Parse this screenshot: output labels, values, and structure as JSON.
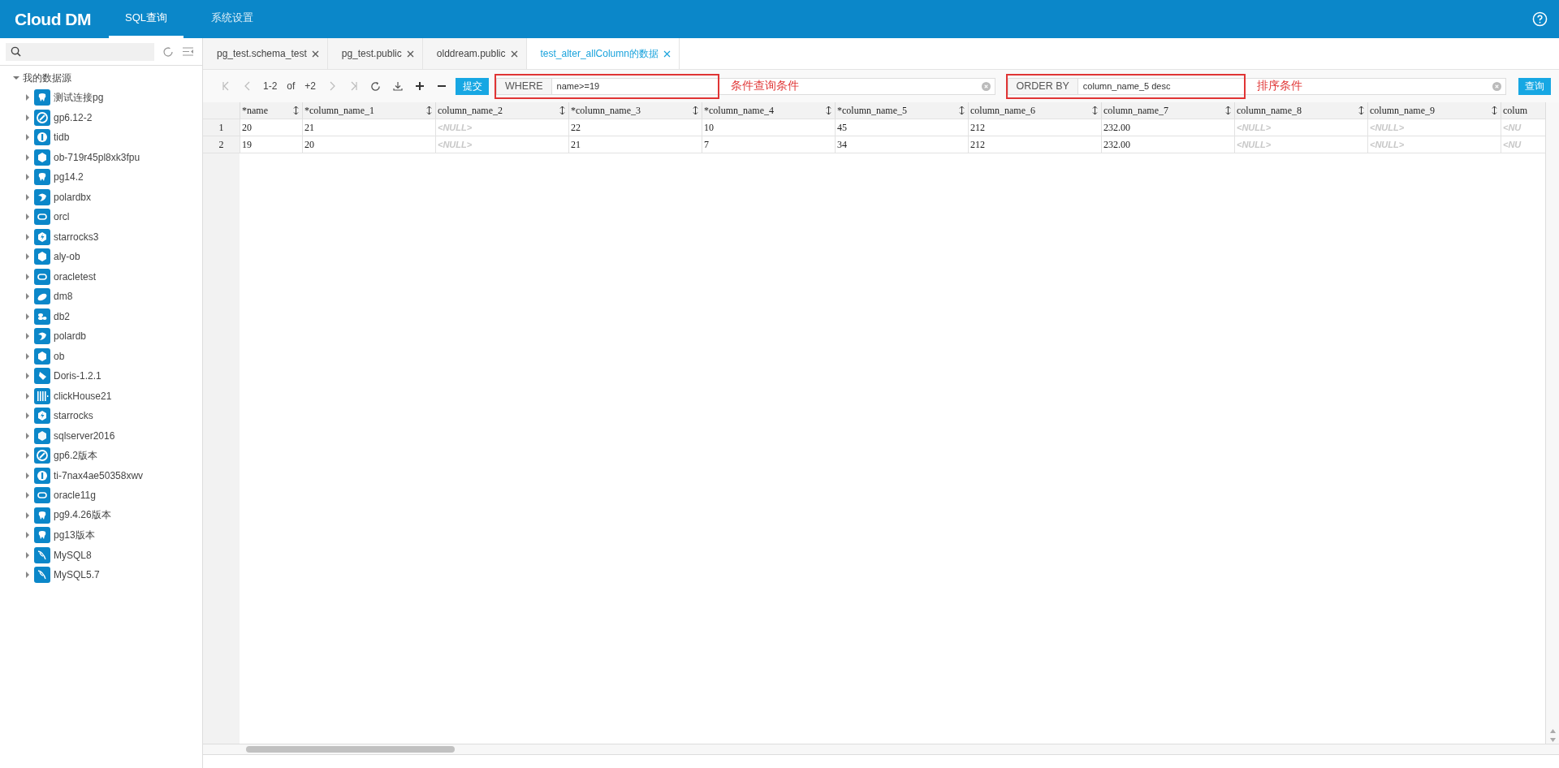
{
  "app": {
    "logo": "Cloud DM",
    "nav": [
      {
        "label": "SQL查询",
        "selected": true
      },
      {
        "label": "系统设置",
        "selected": false
      }
    ]
  },
  "sidebar": {
    "tree": {
      "label": "我的数据源",
      "expanded": true,
      "children": [
        {
          "label": "测试连接pg",
          "kind": "pg"
        },
        {
          "label": "gp6.12-2",
          "kind": "gp"
        },
        {
          "label": "tidb",
          "kind": "tidb"
        },
        {
          "label": "ob-719r45pl8xk3fpu",
          "kind": "ob"
        },
        {
          "label": "pg14.2",
          "kind": "pg"
        },
        {
          "label": "polardbx",
          "kind": "polar"
        },
        {
          "label": "orcl",
          "kind": "oracle"
        },
        {
          "label": "starrocks3",
          "kind": "starrocks"
        },
        {
          "label": "aly-ob",
          "kind": "ob"
        },
        {
          "label": "oracletest",
          "kind": "oracle"
        },
        {
          "label": "dm8",
          "kind": "dm"
        },
        {
          "label": "db2",
          "kind": "db2"
        },
        {
          "label": "polardb",
          "kind": "polar"
        },
        {
          "label": "ob",
          "kind": "ob"
        },
        {
          "label": "Doris-1.2.1",
          "kind": "doris"
        },
        {
          "label": "clickHouse21",
          "kind": "clickhouse"
        },
        {
          "label": "starrocks",
          "kind": "starrocks"
        },
        {
          "label": "sqlserver2016",
          "kind": "sqlserver"
        },
        {
          "label": "gp6.2版本",
          "kind": "gp"
        },
        {
          "label": "ti-7nax4ae50358xwv",
          "kind": "tidb"
        },
        {
          "label": "oracle11g",
          "kind": "oracle"
        },
        {
          "label": "pg9.4.26版本",
          "kind": "pg"
        },
        {
          "label": "pg13版本",
          "kind": "pg"
        },
        {
          "label": "MySQL8",
          "kind": "mysql"
        },
        {
          "label": "MySQL5.7",
          "kind": "mysql"
        }
      ]
    }
  },
  "tabs": [
    {
      "label": "pg_test.schema_test",
      "selected": false
    },
    {
      "label": "pg_test.public",
      "selected": false
    },
    {
      "label": "olddream.public",
      "selected": false
    },
    {
      "label": "test_alter_allColumn的数据",
      "selected": true
    }
  ],
  "pager": {
    "range": "1-2",
    "of": "of",
    "total": "+2"
  },
  "submit_button": "提交",
  "filters": [
    {
      "keyword": "WHERE",
      "value": "name>=19",
      "note": "条件查询条件"
    },
    {
      "keyword": "ORDER BY",
      "value": "column_name_5 desc",
      "note": "排序条件"
    }
  ],
  "query_button": "查询",
  "table": {
    "columns": [
      {
        "label": "*name",
        "sortable": true
      },
      {
        "label": "*column_name_1",
        "sortable": true
      },
      {
        "label": "column_name_2",
        "sortable": true
      },
      {
        "label": "*column_name_3",
        "sortable": true
      },
      {
        "label": "*column_name_4",
        "sortable": true
      },
      {
        "label": "*column_name_5",
        "sortable": true
      },
      {
        "label": "column_name_6",
        "sortable": true
      },
      {
        "label": "column_name_7",
        "sortable": true
      },
      {
        "label": "column_name_8",
        "sortable": true
      },
      {
        "label": "column_name_9",
        "sortable": true
      },
      {
        "label": "colum",
        "sortable": false
      }
    ],
    "rows": [
      {
        "number": "1",
        "cells": [
          {
            "text": "20",
            "is_null": false
          },
          {
            "text": "21",
            "is_null": false
          },
          {
            "text": "<NULL>",
            "is_null": true
          },
          {
            "text": "22",
            "is_null": false
          },
          {
            "text": "10",
            "is_null": false
          },
          {
            "text": "45",
            "is_null": false
          },
          {
            "text": "212",
            "is_null": false
          },
          {
            "text": "232.00",
            "is_null": false
          },
          {
            "text": "<NULL>",
            "is_null": true
          },
          {
            "text": "<NULL>",
            "is_null": true
          },
          {
            "text": "<NU",
            "is_null": true
          }
        ]
      },
      {
        "number": "2",
        "cells": [
          {
            "text": "19",
            "is_null": false
          },
          {
            "text": "20",
            "is_null": false
          },
          {
            "text": "<NULL>",
            "is_null": true
          },
          {
            "text": "21",
            "is_null": false
          },
          {
            "text": "7",
            "is_null": false
          },
          {
            "text": "34",
            "is_null": false
          },
          {
            "text": "212",
            "is_null": false
          },
          {
            "text": "232.00",
            "is_null": false
          },
          {
            "text": "<NULL>",
            "is_null": true
          },
          {
            "text": "<NULL>",
            "is_null": true
          },
          {
            "text": "<NU",
            "is_null": true
          }
        ]
      }
    ]
  }
}
